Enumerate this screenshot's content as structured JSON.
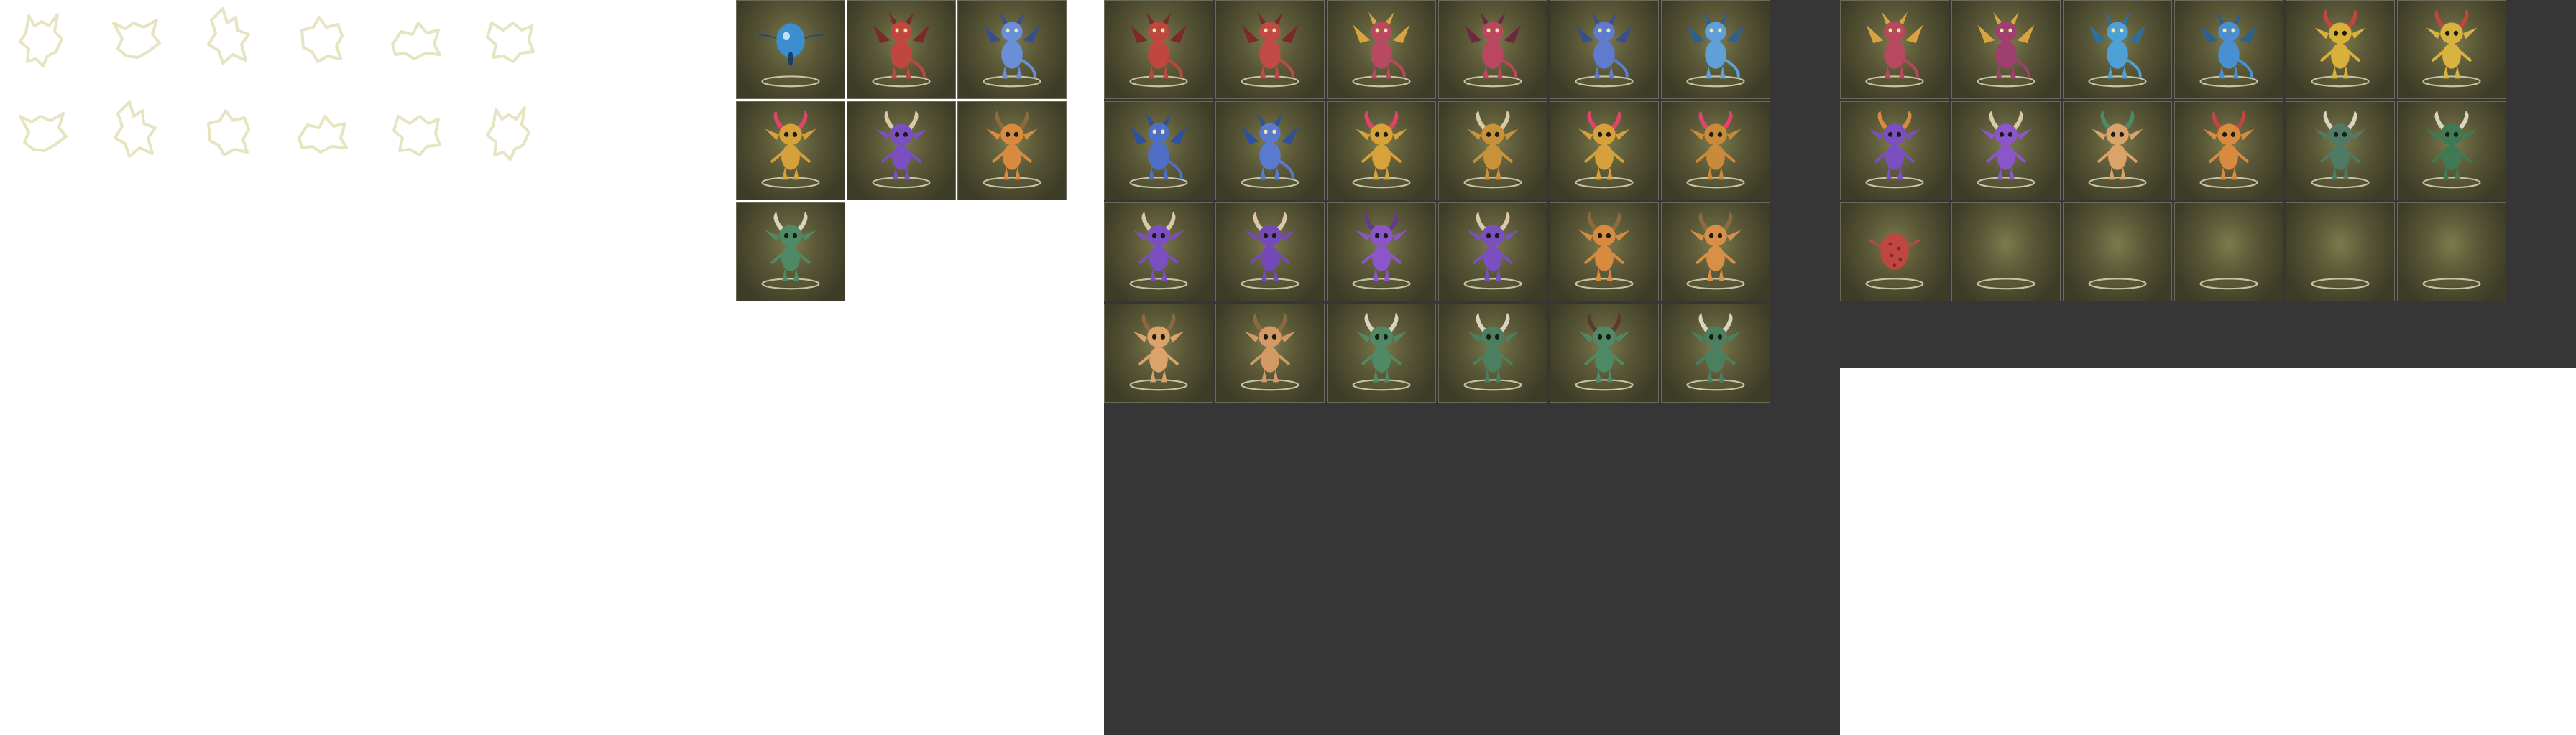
{
  "sheet_labels": {
    "silhouettes": "silhouette-sheet",
    "a": "portrait-sheet-a",
    "b": "portrait-sheet-b",
    "c": "portrait-sheet-c"
  },
  "silhouettes": [
    {
      "icon": "creature-silhouette-icon"
    },
    {
      "icon": "creature-silhouette-icon"
    },
    {
      "icon": "creature-silhouette-icon"
    },
    {
      "icon": "creature-silhouette-icon"
    },
    {
      "icon": "creature-silhouette-icon"
    },
    {
      "icon": "creature-silhouette-icon"
    },
    {
      "icon": "creature-silhouette-icon"
    },
    {
      "icon": "creature-silhouette-icon"
    },
    {
      "icon": "creature-silhouette-icon"
    },
    {
      "icon": "creature-silhouette-icon"
    },
    {
      "icon": "creature-silhouette-icon"
    },
    {
      "icon": "creature-silhouette-icon"
    }
  ],
  "sheet_a": [
    {
      "kind": "blob",
      "color": "#3b8fd0",
      "accent": "#1a3f66"
    },
    {
      "kind": "dragon",
      "color": "#c0473f",
      "accent": "#7a2a28"
    },
    {
      "kind": "dragon",
      "color": "#6b8fd6",
      "accent": "#3a4f8a"
    },
    {
      "kind": "imp",
      "color": "#d6a13a",
      "accent": "#e0446a"
    },
    {
      "kind": "imp",
      "color": "#7b4fbf",
      "accent": "#d9c9a6"
    },
    {
      "kind": "imp",
      "color": "#d88a3f",
      "accent": "#8a6a3f"
    },
    {
      "kind": "imp",
      "color": "#4f8a66",
      "accent": "#d9d3bf"
    }
  ],
  "sheet_b": [
    {
      "kind": "dragon",
      "color": "#c0473f",
      "accent": "#7a2a28"
    },
    {
      "kind": "dragon",
      "color": "#c14a45",
      "accent": "#7a2a28"
    },
    {
      "kind": "dragon",
      "color": "#b84a5f",
      "accent": "#d9a33f"
    },
    {
      "kind": "dragon",
      "color": "#b8475f",
      "accent": "#6a2a40"
    },
    {
      "kind": "dragon",
      "color": "#5e7bd0",
      "accent": "#3a4f8a"
    },
    {
      "kind": "dragon",
      "color": "#5fa0d6",
      "accent": "#2f5f8f"
    },
    {
      "kind": "dragon",
      "color": "#4f6fc6",
      "accent": "#2f4f9f"
    },
    {
      "kind": "dragon",
      "color": "#5a7ad0",
      "accent": "#2f4f9f"
    },
    {
      "kind": "imp",
      "color": "#d8a23a",
      "accent": "#e0446a"
    },
    {
      "kind": "imp",
      "color": "#c9913a",
      "accent": "#d9c9a6"
    },
    {
      "kind": "imp",
      "color": "#d6a13a",
      "accent": "#e0446a"
    },
    {
      "kind": "imp",
      "color": "#c98a3a",
      "accent": "#e0446a"
    },
    {
      "kind": "imp",
      "color": "#7b4fbf",
      "accent": "#d9c9a6"
    },
    {
      "kind": "imp",
      "color": "#7549b8",
      "accent": "#d9c9a6"
    },
    {
      "kind": "imp",
      "color": "#8a56c9",
      "accent": "#5f3a8f"
    },
    {
      "kind": "imp",
      "color": "#7a4fc0",
      "accent": "#d9c9a6"
    },
    {
      "kind": "imp",
      "color": "#d88a3f",
      "accent": "#8a6a3f"
    },
    {
      "kind": "imp",
      "color": "#d98f46",
      "accent": "#8a6a3f"
    },
    {
      "kind": "imp",
      "color": "#d9a36a",
      "accent": "#8a6a3f"
    },
    {
      "kind": "imp",
      "color": "#d39a66",
      "accent": "#8a6a3f"
    },
    {
      "kind": "imp",
      "color": "#4f8a66",
      "accent": "#d9d3bf"
    },
    {
      "kind": "imp",
      "color": "#4a7f60",
      "accent": "#d9d3bf"
    },
    {
      "kind": "imp",
      "color": "#4f8a66",
      "accent": "#5a3a2a"
    },
    {
      "kind": "imp",
      "color": "#4a8060",
      "accent": "#d9d3bf"
    }
  ],
  "sheet_c": [
    {
      "kind": "dragon",
      "color": "#b8475f",
      "accent": "#d9a33f"
    },
    {
      "kind": "dragon",
      "color": "#9f3f6f",
      "accent": "#d9a33f"
    },
    {
      "kind": "dragon",
      "color": "#4fa0d6",
      "accent": "#2f6f9f"
    },
    {
      "kind": "dragon",
      "color": "#4a8fd0",
      "accent": "#2f5f8f"
    },
    {
      "kind": "imp",
      "color": "#d9b03a",
      "accent": "#c0473f"
    },
    {
      "kind": "imp",
      "color": "#d9b33f",
      "accent": "#c0473f"
    },
    {
      "kind": "imp",
      "color": "#7b4fbf",
      "accent": "#d98a3f"
    },
    {
      "kind": "imp",
      "color": "#8a56c9",
      "accent": "#d9c9a6"
    },
    {
      "kind": "imp",
      "color": "#d9a36a",
      "accent": "#4f8a66"
    },
    {
      "kind": "imp",
      "color": "#d88a3f",
      "accent": "#c0473f"
    },
    {
      "kind": "imp",
      "color": "#4f7a66",
      "accent": "#d9d3bf"
    },
    {
      "kind": "imp",
      "color": "#3f7a55",
      "accent": "#d9d3bf"
    },
    {
      "kind": "egg",
      "color": "#c0473f",
      "accent": "#7a2a28"
    },
    {
      "kind": "empty"
    },
    {
      "kind": "empty"
    },
    {
      "kind": "empty"
    },
    {
      "kind": "empty"
    },
    {
      "kind": "empty"
    }
  ]
}
